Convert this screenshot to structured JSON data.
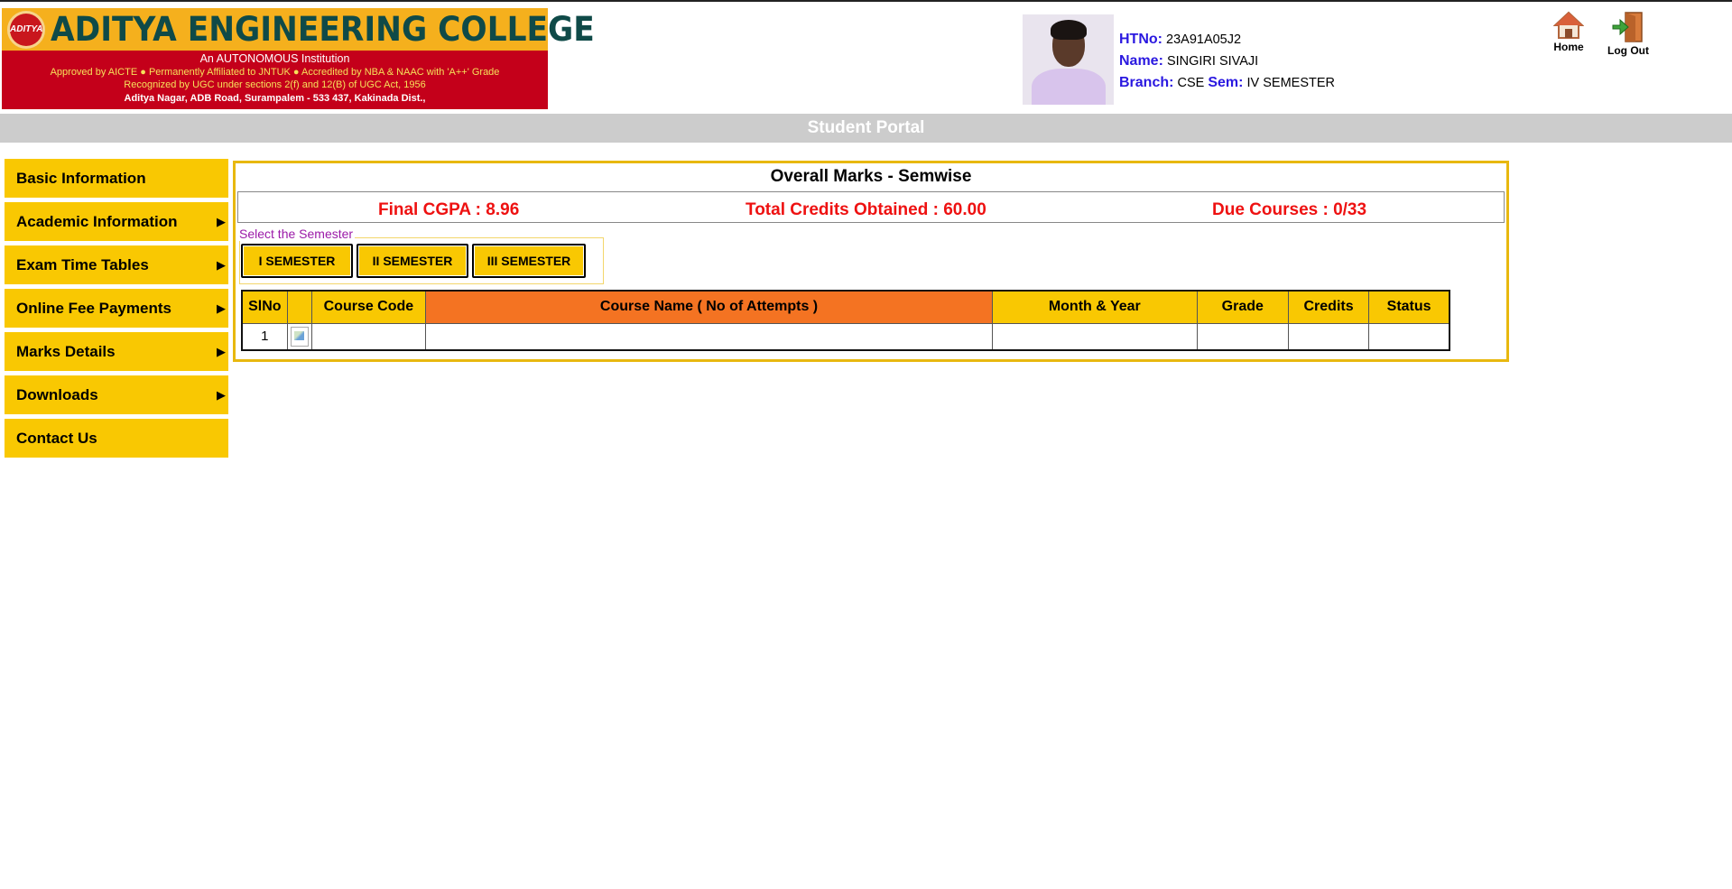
{
  "banner": {
    "logo_text": "ADITYA",
    "title": "ADITYA ENGINEERING COLLEGE",
    "line1": "An AUTONOMOUS Institution",
    "line2": "Approved by AICTE ● Permanently Affiliated to JNTUK ● Accredited by NBA & NAAC with 'A++' Grade",
    "line3": "Recognized by UGC under sections 2(f) and 12(B) of UGC Act, 1956",
    "line4": "Aditya Nagar, ADB Road, Surampalem - 533 437, Kakinada Dist.,"
  },
  "student": {
    "htno_label": "HTNo:",
    "htno": "23A91A05J2",
    "name_label": "Name:",
    "name": "SINGIRI SIVAJI",
    "branch_label": "Branch:",
    "branch": "CSE",
    "sem_label": "Sem:",
    "sem": "IV SEMESTER"
  },
  "actions": {
    "home_label": "Home",
    "logout_label": "Log Out"
  },
  "portal_title": "Student Portal",
  "sidebar": {
    "items": [
      {
        "label": "Basic Information",
        "has_submenu": false
      },
      {
        "label": "Academic Information",
        "has_submenu": true
      },
      {
        "label": "Exam Time Tables",
        "has_submenu": true
      },
      {
        "label": "Online Fee Payments",
        "has_submenu": true
      },
      {
        "label": "Marks Details",
        "has_submenu": true
      },
      {
        "label": "Downloads",
        "has_submenu": true
      },
      {
        "label": "Contact Us",
        "has_submenu": false
      }
    ]
  },
  "main": {
    "title": "Overall Marks - Semwise",
    "cgpa": "Final CGPA : 8.96",
    "credits": "Total Credits Obtained : 60.00",
    "due": "Due Courses : 0/33",
    "sem_select_legend": "Select the Semester",
    "sem_buttons": [
      "I SEMESTER",
      "II SEMESTER",
      "III SEMESTER"
    ],
    "table": {
      "headers": [
        "SlNo",
        "",
        "Course Code",
        "Course Name ( No of Attempts )",
        "Month & Year",
        "Grade",
        "Credits",
        "Status"
      ],
      "rows": [
        {
          "slno": "1",
          "course_code": "",
          "course_name": "",
          "month_year": "",
          "grade": "",
          "credits": "",
          "status": ""
        }
      ]
    }
  },
  "colors": {
    "accent_yellow": "#f9c802",
    "accent_orange": "#f47322",
    "summary_red": "#ee1111",
    "label_blue": "#2a18e0",
    "portal_bar": "#cccccc"
  }
}
